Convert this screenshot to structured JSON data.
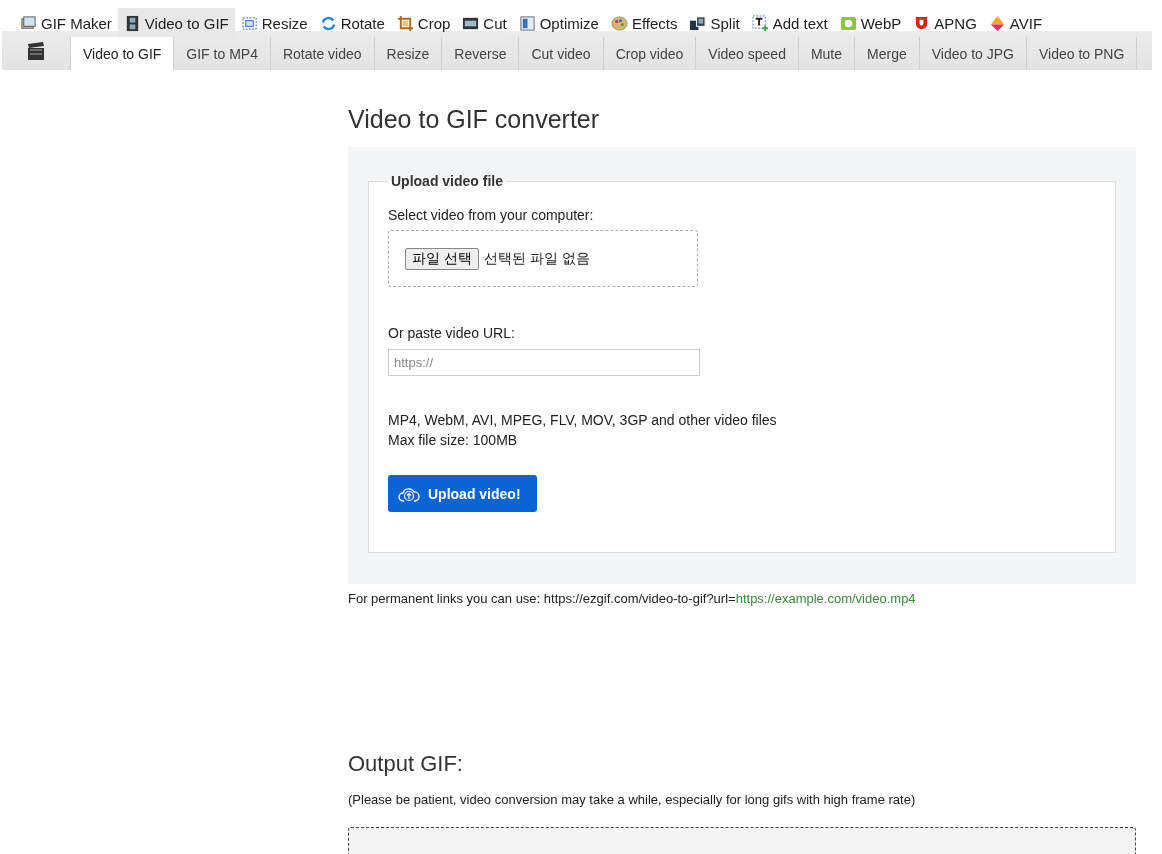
{
  "top_nav": [
    {
      "label": "GIF Maker",
      "selected": false
    },
    {
      "label": "Video to GIF",
      "selected": true
    },
    {
      "label": "Resize",
      "selected": false
    },
    {
      "label": "Rotate",
      "selected": false
    },
    {
      "label": "Crop",
      "selected": false
    },
    {
      "label": "Cut",
      "selected": false
    },
    {
      "label": "Optimize",
      "selected": false
    },
    {
      "label": "Effects",
      "selected": false
    },
    {
      "label": "Split",
      "selected": false
    },
    {
      "label": "Add text",
      "selected": false
    },
    {
      "label": "WebP",
      "selected": false
    },
    {
      "label": "APNG",
      "selected": false
    },
    {
      "label": "AVIF",
      "selected": false
    }
  ],
  "sub_tabs": [
    {
      "label": "Video to GIF",
      "selected": true
    },
    {
      "label": "GIF to MP4",
      "selected": false
    },
    {
      "label": "Rotate video",
      "selected": false
    },
    {
      "label": "Resize",
      "selected": false
    },
    {
      "label": "Reverse",
      "selected": false
    },
    {
      "label": "Cut video",
      "selected": false
    },
    {
      "label": "Crop video",
      "selected": false
    },
    {
      "label": "Video speed",
      "selected": false
    },
    {
      "label": "Mute",
      "selected": false
    },
    {
      "label": "Merge",
      "selected": false
    },
    {
      "label": "Video to JPG",
      "selected": false
    },
    {
      "label": "Video to PNG",
      "selected": false
    }
  ],
  "title": "Video to GIF converter",
  "upload": {
    "legend": "Upload video file",
    "file_label": "Select video from your computer:",
    "file_button": "파일 선택",
    "file_status": "선택된 파일 없음",
    "url_label": "Or paste video URL:",
    "url_placeholder": "https://",
    "formats": "MP4, WebM, AVI, MPEG, FLV, MOV, 3GP and other video files",
    "max_size": "Max file size: 100MB",
    "submit": "Upload video!"
  },
  "permanent_link": {
    "prefix": "For permanent links you can use: https://ezgif.com/video-to-gif?url=",
    "example": "https://example.com/video.mp4"
  },
  "output": {
    "heading": "Output GIF:",
    "note": "(Please be patient, video conversion may take a while, especially for long gifs with high frame rate)"
  }
}
